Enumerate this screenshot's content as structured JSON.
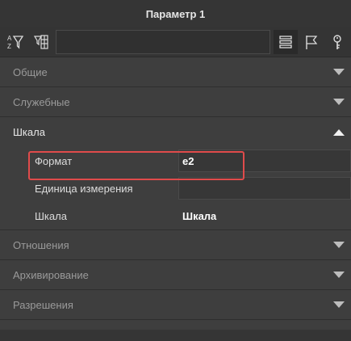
{
  "panel": {
    "title": "Параметр 1"
  },
  "toolbar": {
    "buttons": [
      {
        "icon": "sort-az-filter-icon"
      },
      {
        "icon": "filter-grid-icon"
      },
      {
        "icon": "list-view-icon"
      },
      {
        "icon": "flag-icon"
      },
      {
        "icon": "key-icon"
      }
    ],
    "search_value": ""
  },
  "sections": {
    "general": "Общие",
    "service": "Служебные",
    "scale": "Шкала",
    "relations": "Отношения",
    "archiving": "Архивирование",
    "permissions": "Разрешения"
  },
  "scale_props": [
    {
      "label": "Формат",
      "value": "e2"
    },
    {
      "label": "Единица измерения",
      "value": ""
    },
    {
      "label": "Шкала",
      "value": "Шкала"
    }
  ],
  "colors": {
    "highlight": "#e04b4b",
    "background": "#3e3e3e"
  }
}
